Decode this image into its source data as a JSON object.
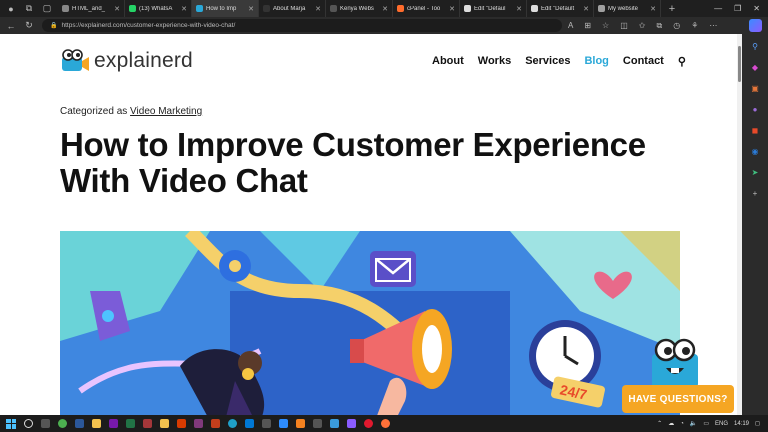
{
  "browser": {
    "tabs": [
      {
        "label": "HTML_and_",
        "color": "#888888"
      },
      {
        "label": "(13) WhatsA",
        "color": "#25d366"
      },
      {
        "label": "How to Imp",
        "color": "#2aa8d8",
        "active": true
      },
      {
        "label": "About Marja",
        "color": "#333333"
      },
      {
        "label": "Kenya Webs",
        "color": "#555555"
      },
      {
        "label": "cPanel - Too",
        "color": "#ff6c2c"
      },
      {
        "label": "Edit \"Defaul",
        "color": "#dddddd"
      },
      {
        "label": "Edit \"Default",
        "color": "#dddddd"
      },
      {
        "label": "My website",
        "color": "#a0a0a0"
      }
    ],
    "url": "https://explainerd.com/customer-experience-with-video-chat/"
  },
  "site": {
    "logo_text": "explainerd",
    "menu": [
      "About",
      "Works",
      "Services",
      "Blog",
      "Contact"
    ],
    "active_menu": "Blog"
  },
  "article": {
    "category_prefix": "Categorized as",
    "category_link": "Video Marketing",
    "title": "How to Improve Customer Experience With Video Chat"
  },
  "hero": {
    "badge_text": "24/7"
  },
  "chat_widget": {
    "label": "HAVE QUESTIONS?"
  },
  "taskbar": {
    "lang": "ENG",
    "time": "14:19"
  },
  "colors": {
    "accent": "#2aa8d8",
    "cta": "#f5a623"
  }
}
